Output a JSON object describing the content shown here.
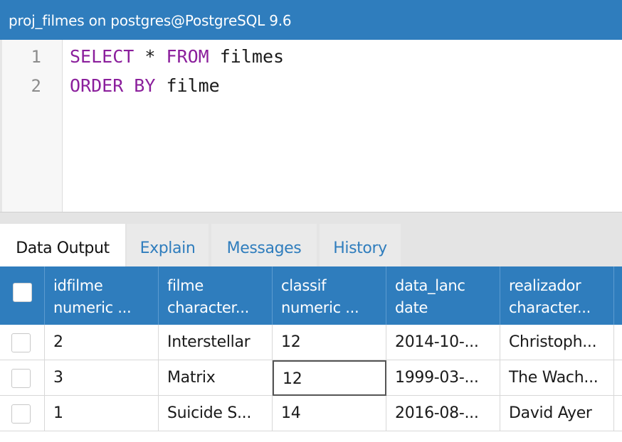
{
  "window": {
    "title": "proj_filmes on postgres@PostgreSQL 9.6"
  },
  "editor": {
    "lines": [
      {
        "number": "1",
        "keyword1": "SELECT",
        "text1": " * ",
        "keyword2": "FROM",
        "text2": " filmes"
      },
      {
        "number": "2",
        "keyword1": "ORDER BY",
        "text1": " filme"
      }
    ],
    "keyword_color": "#8b1f9c"
  },
  "tabs": [
    {
      "label": "Data Output",
      "active": true
    },
    {
      "label": "Explain",
      "active": false
    },
    {
      "label": "Messages",
      "active": false
    },
    {
      "label": "History",
      "active": false
    }
  ],
  "grid": {
    "columns": [
      {
        "name": "idfilme",
        "type": "numeric ..."
      },
      {
        "name": "filme",
        "type": "character..."
      },
      {
        "name": "classif",
        "type": "numeric ..."
      },
      {
        "name": "data_lanc",
        "type": "date"
      },
      {
        "name": "realizador",
        "type": "character..."
      }
    ],
    "rows": [
      [
        "2",
        "Interstellar",
        "12",
        "2014-10-...",
        "Christoph..."
      ],
      [
        "3",
        "Matrix",
        "12",
        "1999-03-...",
        "The Wach..."
      ],
      [
        "1",
        "Suicide S...",
        "14",
        "2016-08-...",
        "David Ayer"
      ]
    ],
    "header_color": "#2f7dbd",
    "selected_cell": {
      "row": 1,
      "column": 2
    }
  }
}
